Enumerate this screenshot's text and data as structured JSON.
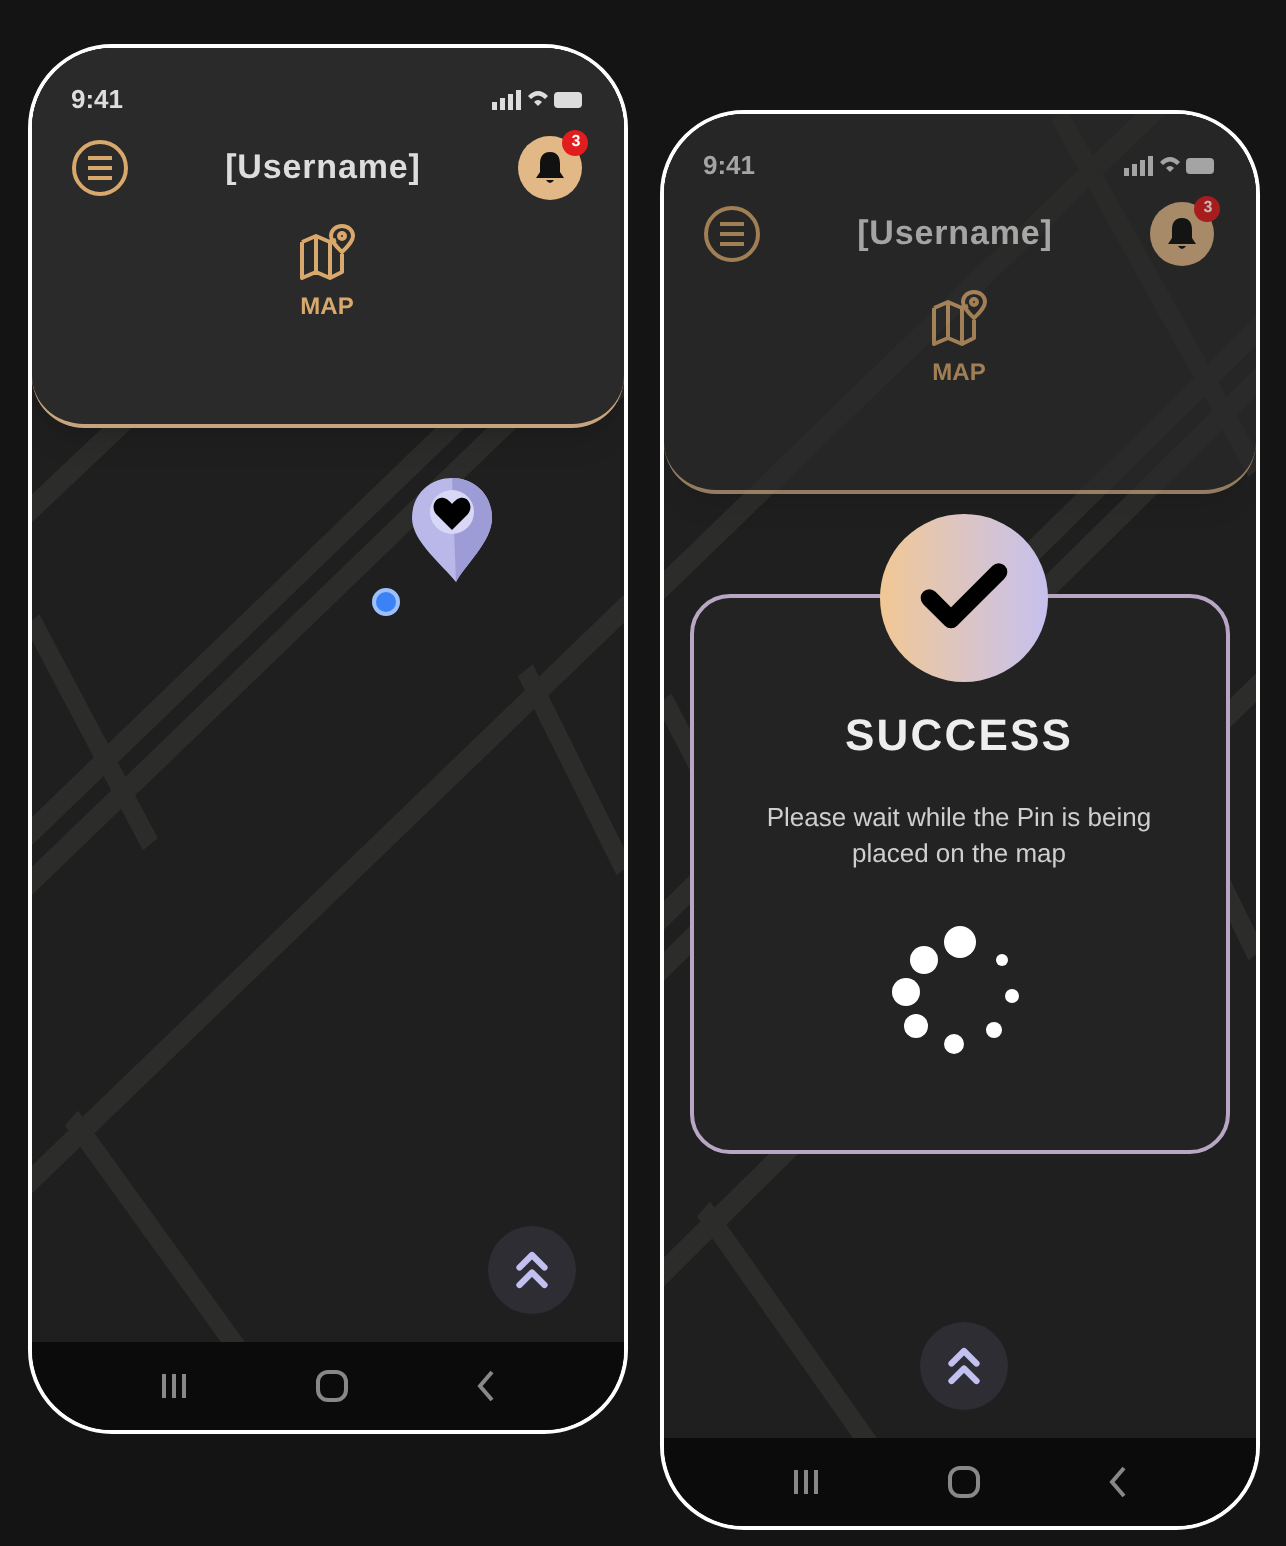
{
  "phones": [
    {
      "status_bar": {
        "time": "9:41"
      },
      "header": {
        "title": "[Username]",
        "notification_count": "3",
        "tab": {
          "label": "MAP"
        }
      }
    },
    {
      "status_bar": {
        "time": "9:41"
      },
      "header": {
        "title": "[Username]",
        "notification_count": "3",
        "tab": {
          "label": "MAP"
        }
      },
      "dialog": {
        "title": "SUCCESS",
        "message": "Please wait while the Pin is being placed on the map"
      }
    }
  ]
}
